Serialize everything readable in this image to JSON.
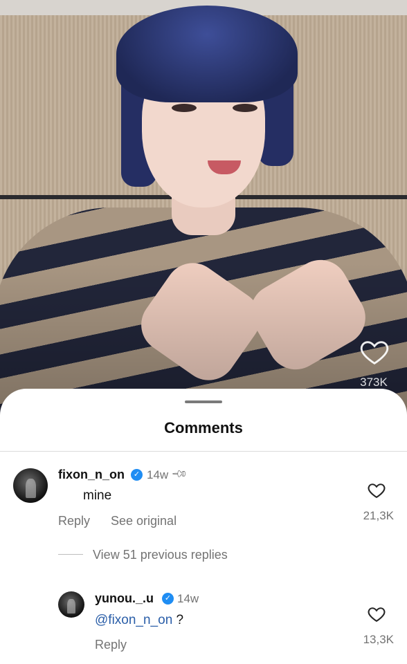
{
  "post": {
    "like_count": "373K",
    "like_icon": "heart-outline-icon"
  },
  "comments_sheet": {
    "title": "Comments"
  },
  "comments": [
    {
      "username": "fixon_n_on",
      "verified": true,
      "time": "14w",
      "pinned": true,
      "text": "mine",
      "reply_label": "Reply",
      "see_original_label": "See original",
      "likes": "21,3K",
      "view_replies_label": "View 51 previous replies"
    }
  ],
  "replies": [
    {
      "username": "yunou._.u",
      "verified": true,
      "time": "14w",
      "mention": "@fixon_n_on",
      "text_after_mention": " ?",
      "reply_label": "Reply",
      "likes": "13,3K"
    }
  ],
  "colors": {
    "verified_badge": "#1f8df3",
    "mention": "#2a5ea8",
    "secondary_text": "#737373"
  }
}
